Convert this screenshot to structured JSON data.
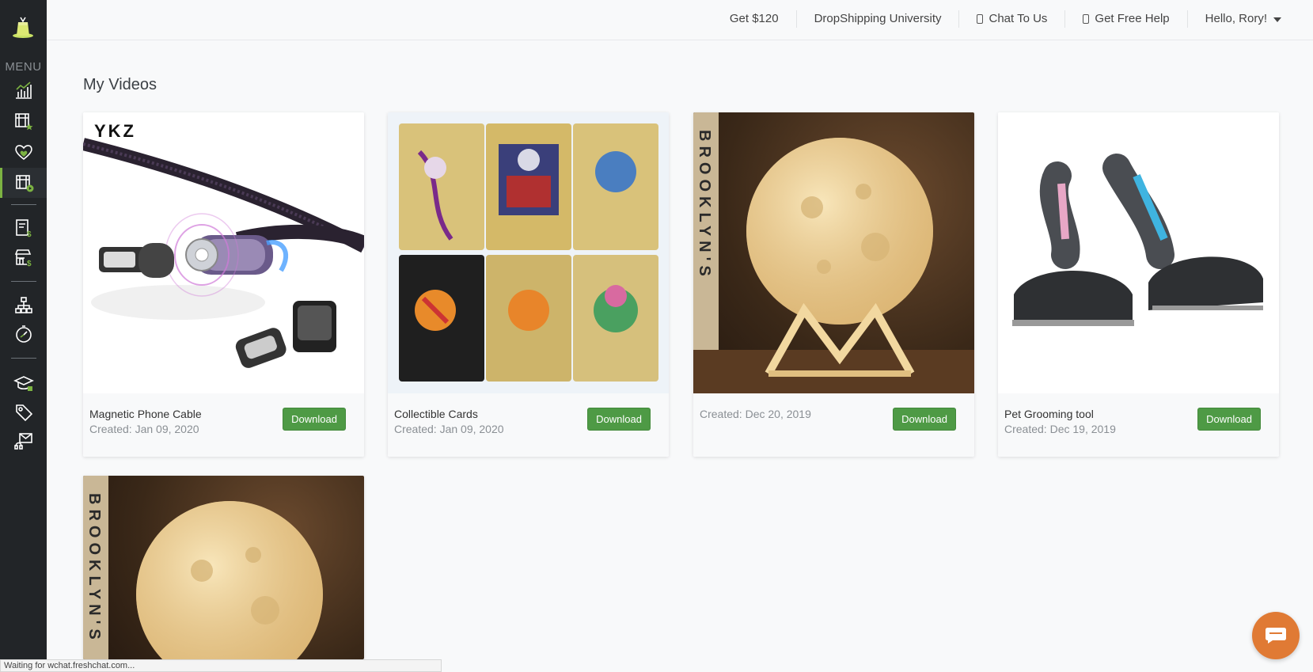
{
  "sidebar": {
    "menu_label": "MENU",
    "items": [
      {
        "icon": "analytics-icon"
      },
      {
        "icon": "video-star-icon"
      },
      {
        "icon": "heart-favorites-icon"
      },
      {
        "icon": "my-videos-icon",
        "active": true
      },
      {
        "icon": "store-list-icon"
      },
      {
        "icon": "shop-icon"
      },
      {
        "icon": "organization-icon"
      },
      {
        "icon": "timer-icon"
      },
      {
        "icon": "university-cap-icon"
      },
      {
        "icon": "tag-icon"
      },
      {
        "icon": "mail-headset-icon"
      }
    ],
    "accent": "#7cb342"
  },
  "topnav": {
    "get_120": "Get $120",
    "university": "DropShipping University",
    "chat": "Chat To Us",
    "help": "Get Free Help",
    "user": "Hello, Rory!"
  },
  "page": {
    "title": "My Videos"
  },
  "videos": [
    {
      "name": "Magnetic Phone Cable",
      "created": "Created: Jan 09, 2020",
      "download": "Download",
      "thumb": "cable"
    },
    {
      "name": "Collectible Cards",
      "created": "Created: Jan 09, 2020",
      "download": "Download",
      "thumb": "cards"
    },
    {
      "name": "",
      "created": "Created: Dec 20, 2019",
      "download": "Download",
      "thumb": "moon"
    },
    {
      "name": "Pet Grooming tool",
      "created": "Created: Dec 19, 2019",
      "download": "Download",
      "thumb": "pet"
    },
    {
      "name": "",
      "created": "",
      "download": "",
      "thumb": "moon"
    }
  ],
  "thumb_text": {
    "ykz": "YKZ",
    "brooklyns": "BROOKLYN'S"
  },
  "status_bar": "Waiting for wchat.freshchat.com...",
  "colors": {
    "download_button": "#4e9a45",
    "chat_bubble": "#e07a34",
    "sidebar_bg": "#222528"
  }
}
